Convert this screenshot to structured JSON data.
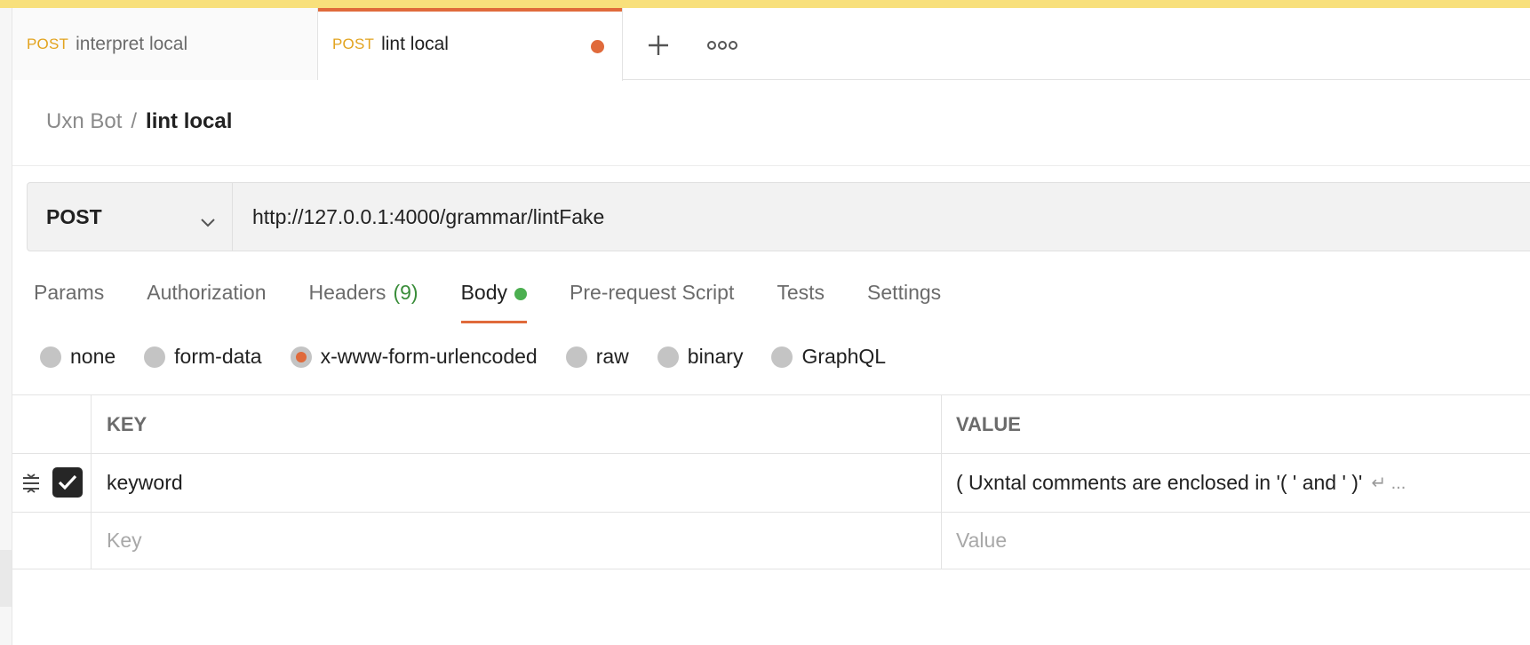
{
  "tabs": [
    {
      "method": "POST",
      "name": "interpret local"
    },
    {
      "method": "POST",
      "name": "lint local",
      "unsaved": true
    }
  ],
  "tab_actions": {
    "new_tab_icon": "plus-icon",
    "more_icon": "more-icon"
  },
  "breadcrumb": {
    "collection": "Uxn Bot",
    "separator": "/",
    "current": "lint local"
  },
  "request": {
    "method": "POST",
    "url": "http://127.0.0.1:4000/grammar/lintFake"
  },
  "request_tabs": {
    "params": "Params",
    "authorization": "Authorization",
    "headers": "Headers",
    "headers_count": "(9)",
    "body": "Body",
    "pre_request": "Pre-request Script",
    "tests": "Tests",
    "settings": "Settings",
    "active": "Body"
  },
  "body_types": {
    "none": "none",
    "form_data": "form-data",
    "urlencoded": "x-www-form-urlencoded",
    "raw": "raw",
    "binary": "binary",
    "graphql": "GraphQL",
    "selected": "x-www-form-urlencoded"
  },
  "table": {
    "key_header": "KEY",
    "value_header": "VALUE",
    "rows": [
      {
        "enabled": true,
        "key": "keyword",
        "value": "( Uxntal comments are enclosed in '( '  and ' )'",
        "value_more": "↵ ..."
      }
    ],
    "new_row": {
      "key_placeholder": "Key",
      "value_placeholder": "Value"
    }
  },
  "colors": {
    "accent": "#e06a3b",
    "method_tag": "#e2a31e",
    "body_indicator": "#4caf50",
    "top_banner": "#f8e07c"
  }
}
